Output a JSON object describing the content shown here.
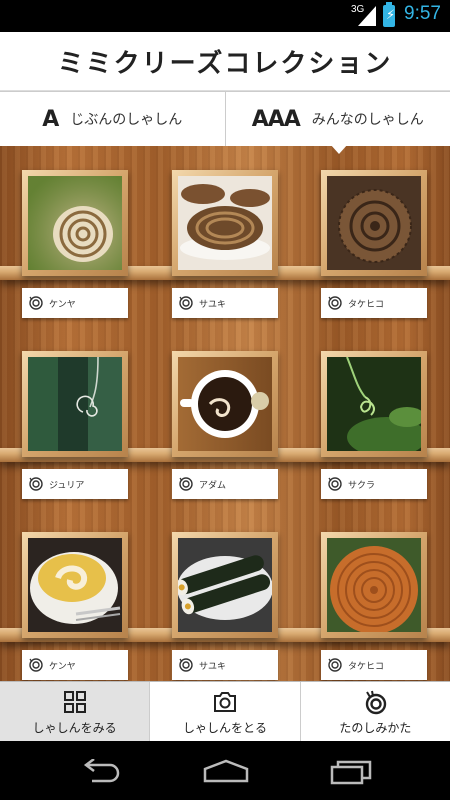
{
  "status": {
    "network": "3G",
    "time": "9:57"
  },
  "app": {
    "title": "ミミクリーズコレクション"
  },
  "tabs": [
    {
      "icon": "A",
      "label": "じぶんのしゃしん"
    },
    {
      "icon": "AAA",
      "label": "みんなのしゃしん"
    }
  ],
  "grid": [
    {
      "label": "ケンヤ",
      "photo": "snail-shell"
    },
    {
      "label": "サユキ",
      "photo": "cinnamon-roll"
    },
    {
      "label": "タケヒコ",
      "photo": "ammonite"
    },
    {
      "label": "ジュリア",
      "photo": "vine-spiral"
    },
    {
      "label": "アダム",
      "photo": "coffee-latte"
    },
    {
      "label": "サクラ",
      "photo": "pea-tendril"
    },
    {
      "label": "ケンヤ",
      "photo": "roll-cake"
    },
    {
      "label": "サユキ",
      "photo": "sushi-rolls"
    },
    {
      "label": "タケヒコ",
      "photo": "tree-rings"
    }
  ],
  "bottom_nav": [
    {
      "label": "しゃしんをみる",
      "icon": "grid-icon"
    },
    {
      "label": "しゃしんをとる",
      "icon": "camera-icon"
    },
    {
      "label": "たのしみかた",
      "icon": "snail-icon"
    }
  ]
}
